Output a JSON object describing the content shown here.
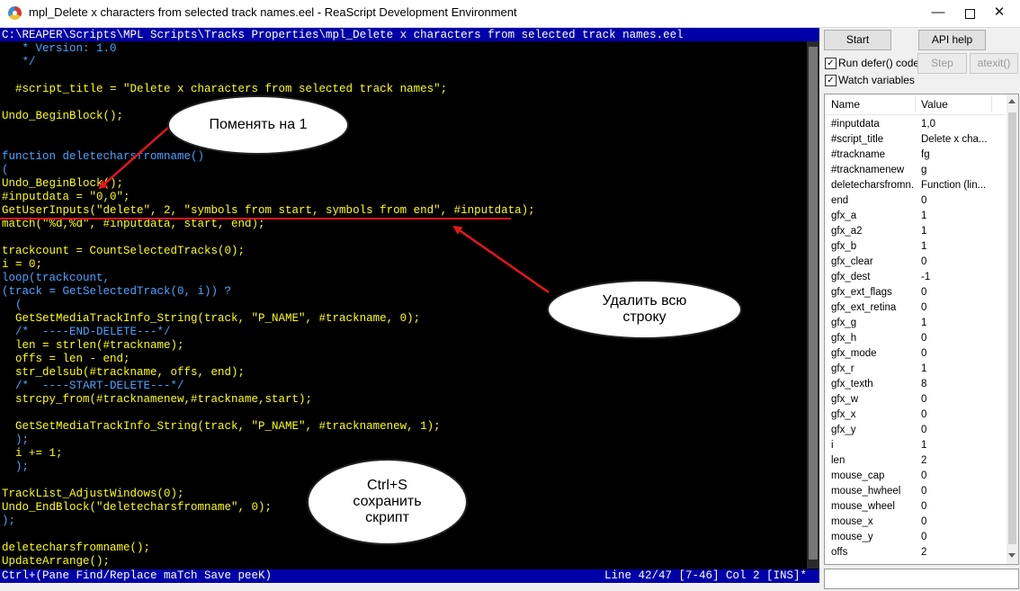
{
  "window": {
    "title": "mpl_Delete x characters from selected track names.eel - ReaScript Development Environment",
    "minimize": "—",
    "close": "✕"
  },
  "editor": {
    "path": "C:\\REAPER\\Scripts\\MPL Scripts\\Tracks Properties\\mpl_Delete x characters from selected track names.eel",
    "lines": [
      {
        "text": "   * Version: 1.0",
        "color": "#4aa3ff"
      },
      {
        "text": "   */",
        "color": "#4aa3ff"
      },
      {
        "text": "",
        "color": "#ffff00"
      },
      {
        "text": "  #script_title = \"Delete x characters from selected track names\";",
        "color": "#ffff00"
      },
      {
        "text": "",
        "color": "#ffff00"
      },
      {
        "text": "Undo_BeginBlock();",
        "color": "#ffff00"
      },
      {
        "text": "",
        "color": "#ffff00"
      },
      {
        "text": "",
        "color": "#ffff00"
      },
      {
        "text": "function deletecharsfromname()",
        "color": "#4aa3ff"
      },
      {
        "text": "(",
        "color": "#4aa3ff"
      },
      {
        "text": "Undo_BeginBlock();",
        "color": "#ffff00"
      },
      {
        "text": "#inputdata = \"0,0\";",
        "color": "#ffff00"
      },
      {
        "text": "GetUserInputs(\"delete\", 2, \"symbols from start, symbols from end\", #inputdata);",
        "color": "#ffff00"
      },
      {
        "text": "match(\"%d,%d\", #inputdata, start, end);",
        "color": "#ffff00"
      },
      {
        "text": "",
        "color": "#ffff00"
      },
      {
        "text": "trackcount = CountSelectedTracks(0);",
        "color": "#ffff00"
      },
      {
        "text": "i = 0;",
        "color": "#ffff00"
      },
      {
        "text": "loop(trackcount,",
        "color": "#4aa3ff"
      },
      {
        "text": "(track = GetSelectedTrack(0, i)) ?",
        "color": "#4aa3ff"
      },
      {
        "text": "  (",
        "color": "#4aa3ff"
      },
      {
        "text": "  GetSetMediaTrackInfo_String(track, \"P_NAME\", #trackname, 0);",
        "color": "#ffff00"
      },
      {
        "text": "  /*  ----END-DELETE---*/",
        "color": "#4aa3ff"
      },
      {
        "text": "  len = strlen(#trackname);",
        "color": "#ffff00"
      },
      {
        "text": "  offs = len - end;",
        "color": "#ffff00"
      },
      {
        "text": "  str_delsub(#trackname, offs, end);",
        "color": "#ffff00"
      },
      {
        "text": "  /*  ----START-DELETE---*/",
        "color": "#4aa3ff"
      },
      {
        "text": "  strcpy_from(#tracknamenew,#trackname,start);",
        "color": "#ffff00"
      },
      {
        "text": "",
        "color": "#ffff00"
      },
      {
        "text": "  GetSetMediaTrackInfo_String(track, \"P_NAME\", #tracknamenew, 1);",
        "color": "#ffff00"
      },
      {
        "text": "  );",
        "color": "#4aa3ff"
      },
      {
        "text": "  i += 1;",
        "color": "#ffff00"
      },
      {
        "text": "  );",
        "color": "#4aa3ff"
      },
      {
        "text": "",
        "color": "#ffff00"
      },
      {
        "text": "TrackList_AdjustWindows(0);",
        "color": "#ffff00"
      },
      {
        "text": "Undo_EndBlock(\"deletecharsfromname\", 0);",
        "color": "#ffff00"
      },
      {
        "text": ");",
        "color": "#4aa3ff"
      },
      {
        "text": "",
        "color": "#ffff00"
      },
      {
        "text": "deletecharsfromname();",
        "color": "#ffff00"
      },
      {
        "text": "UpdateArrange();",
        "color": "#ffff00"
      }
    ]
  },
  "statusbar": {
    "left": "Ctrl+(Pane Find/Replace maTch Save peeK)",
    "right": "Line 42/47 [7-46] Col 2 [INS]*"
  },
  "panel": {
    "start_label": "Start",
    "api_help_label": "API help",
    "run_defer_label": "Run defer() code",
    "run_defer_checked": "✓",
    "step_label": "Step",
    "atexit_label": "atexit()",
    "watch_label": "Watch variables",
    "watch_checked": "✓",
    "col_name": "Name",
    "col_value": "Value",
    "variables": [
      {
        "name": "#inputdata",
        "value": "1,0"
      },
      {
        "name": "#script_title",
        "value": "Delete x cha..."
      },
      {
        "name": "#trackname",
        "value": "fg"
      },
      {
        "name": "#tracknamenew",
        "value": "g"
      },
      {
        "name": "deletecharsfromn...",
        "value": "Function (lin..."
      },
      {
        "name": "end",
        "value": "0"
      },
      {
        "name": "gfx_a",
        "value": "1"
      },
      {
        "name": "gfx_a2",
        "value": "1"
      },
      {
        "name": "gfx_b",
        "value": "1"
      },
      {
        "name": "gfx_clear",
        "value": "0"
      },
      {
        "name": "gfx_dest",
        "value": "-1"
      },
      {
        "name": "gfx_ext_flags",
        "value": "0"
      },
      {
        "name": "gfx_ext_retina",
        "value": "0"
      },
      {
        "name": "gfx_g",
        "value": "1"
      },
      {
        "name": "gfx_h",
        "value": "0"
      },
      {
        "name": "gfx_mode",
        "value": "0"
      },
      {
        "name": "gfx_r",
        "value": "1"
      },
      {
        "name": "gfx_texth",
        "value": "8"
      },
      {
        "name": "gfx_w",
        "value": "0"
      },
      {
        "name": "gfx_x",
        "value": "0"
      },
      {
        "name": "gfx_y",
        "value": "0"
      },
      {
        "name": "i",
        "value": "1"
      },
      {
        "name": "len",
        "value": "2"
      },
      {
        "name": "mouse_cap",
        "value": "0"
      },
      {
        "name": "mouse_hwheel",
        "value": "0"
      },
      {
        "name": "mouse_wheel",
        "value": "0"
      },
      {
        "name": "mouse_x",
        "value": "0"
      },
      {
        "name": "mouse_y",
        "value": "0"
      },
      {
        "name": "offs",
        "value": "2"
      }
    ]
  },
  "annotations": {
    "callout1": "Поменять на 1",
    "callout2_line1": "Удалить всю",
    "callout2_line2": "строку",
    "callout3_line1": "Ctrl+S",
    "callout3_line2": "сохранить",
    "callout3_line3": "скрипт",
    "accent_color": "#e8141b"
  }
}
